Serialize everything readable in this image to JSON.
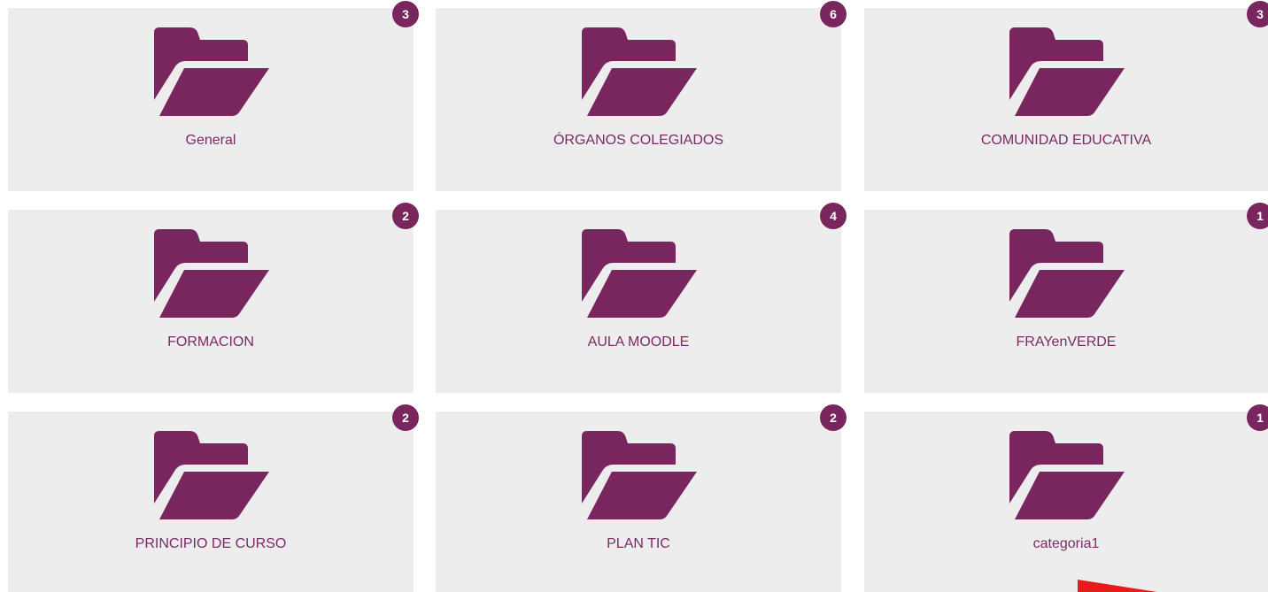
{
  "categories": [
    {
      "label": "General",
      "count": "3"
    },
    {
      "label": "ÓRGANOS COLEGIADOS",
      "count": "6"
    },
    {
      "label": "COMUNIDAD EDUCATIVA",
      "count": "3"
    },
    {
      "label": "FORMACION",
      "count": "2"
    },
    {
      "label": "AULA MOODLE",
      "count": "4"
    },
    {
      "label": "FRAYenVERDE",
      "count": "1"
    },
    {
      "label": "PRINCIPIO DE CURSO",
      "count": "2"
    },
    {
      "label": "PLAN TIC",
      "count": "2"
    },
    {
      "label": "categoria1",
      "count": "1"
    }
  ],
  "icon": "folder-open-icon",
  "colors": {
    "accent": "#79265f",
    "card_bg": "#eeedee",
    "label": "#7a2a63",
    "annotation": "#e81b1b"
  }
}
